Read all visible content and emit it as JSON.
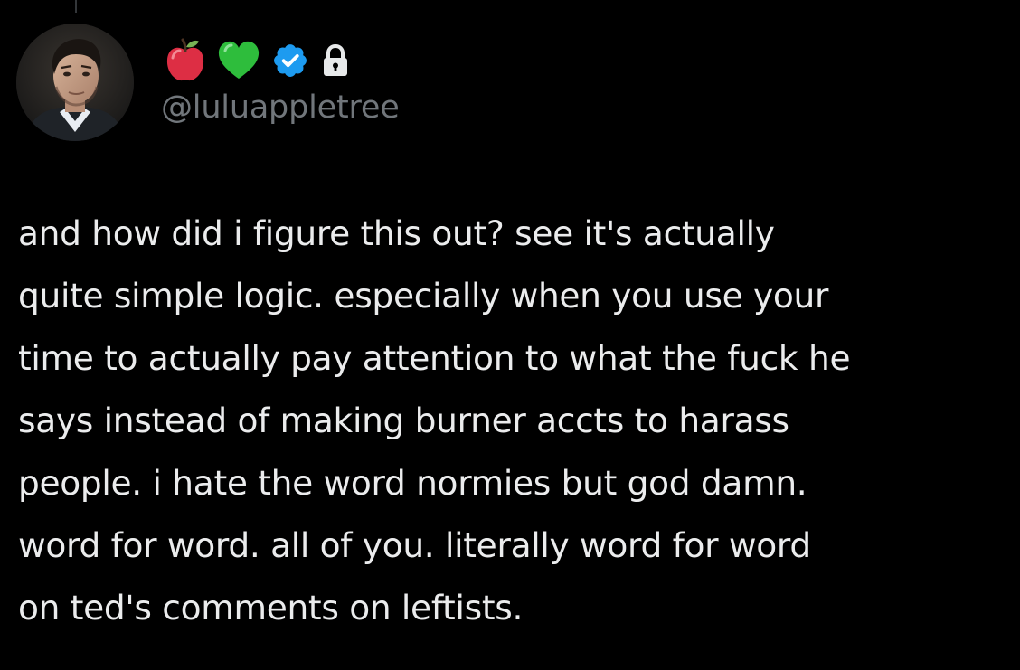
{
  "author": {
    "handle": "@luluappletree",
    "name_emoji_icons": [
      "red-apple-icon",
      "green-heart-icon",
      "verified-badge-icon",
      "lock-icon"
    ]
  },
  "colors": {
    "background": "#000000",
    "text": "#e7e9ea",
    "secondary_text": "#71767b",
    "verified_blue": "#1d9bf0"
  },
  "tweet": {
    "text": "and how did i figure this out? see it's actually\nquite simple logic. especially when you use your\ntime to actually pay attention to what the fuck he\nsays instead of making burner accts to harass\npeople. i hate the word normies but god damn.\nword for word. all of you. literally word for word\non ted's comments on leftists."
  }
}
